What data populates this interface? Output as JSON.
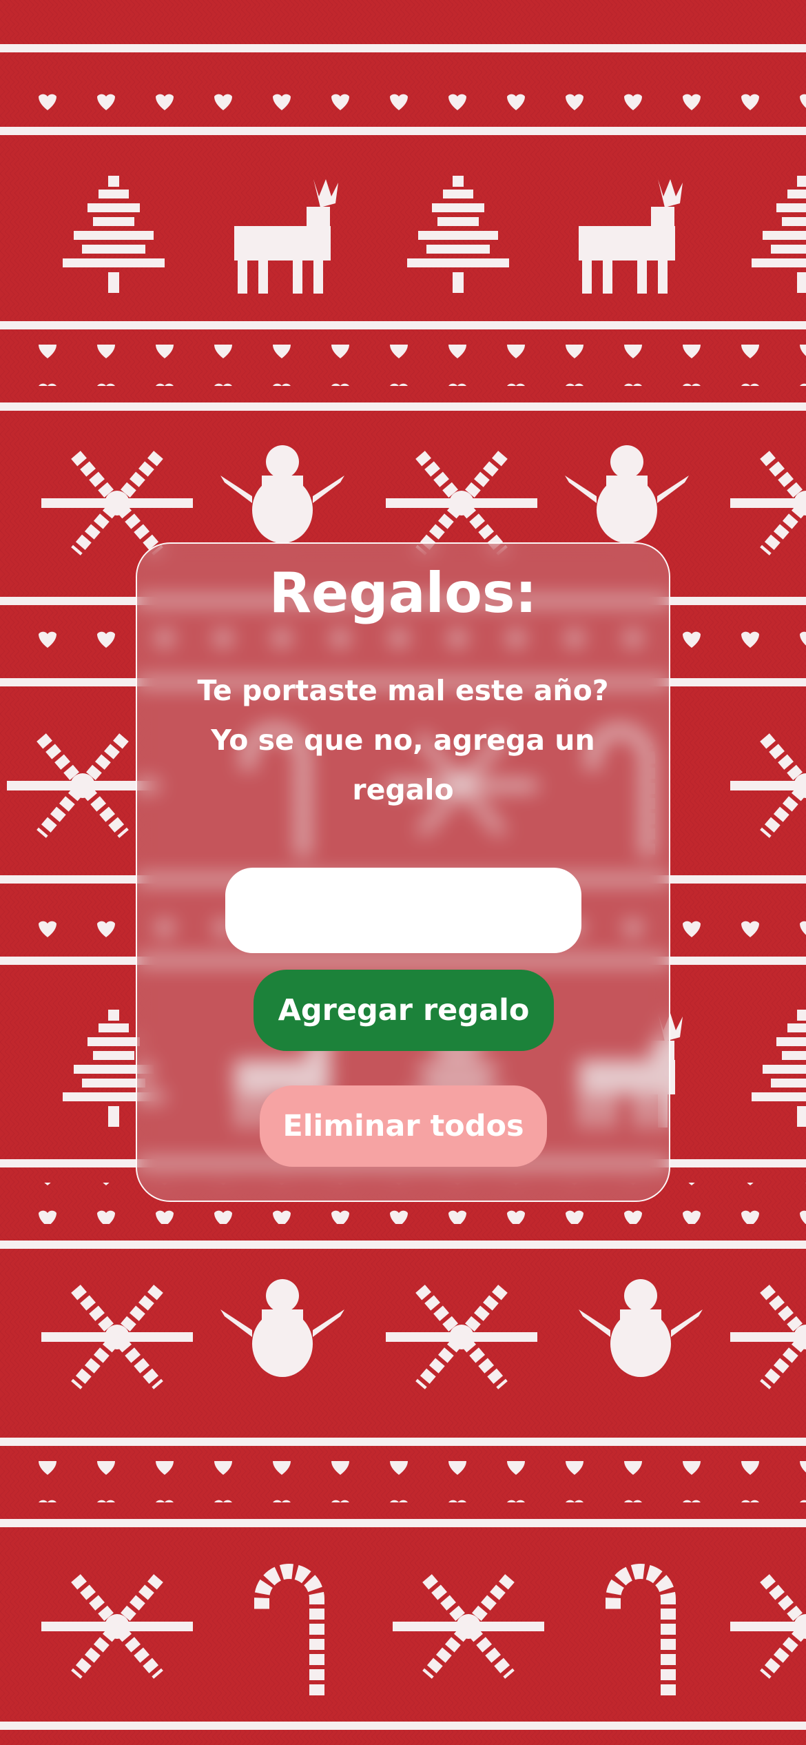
{
  "theme": {
    "background_color": "#c1272d",
    "knit_color": "#f6eff0",
    "add_button_color": "#1c823a",
    "clear_button_color": "#f6a3a3"
  },
  "card": {
    "title": "Regalos:",
    "subtitle": "Te portaste mal este año? Yo se que no, agrega un regalo",
    "input_value": "",
    "add_button_label": "Agregar regalo",
    "clear_button_label": "Eliminar todos"
  },
  "background_motifs": [
    "tree-icon",
    "reindeer-icon",
    "snowflake-icon",
    "snowman-icon",
    "candy-cane-icon",
    "heart-icon"
  ]
}
